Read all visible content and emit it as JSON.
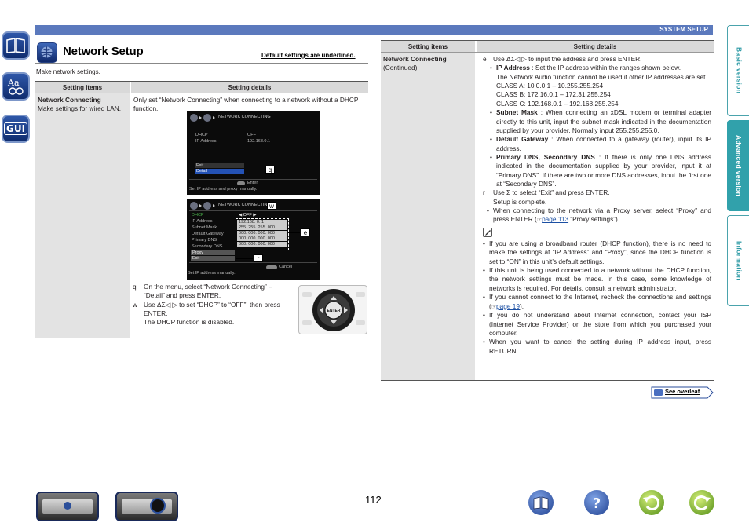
{
  "header": {
    "section": "SYSTEM SETUP"
  },
  "page": {
    "title": "Network Setup",
    "defaults_note": "Default settings are underlined.",
    "intro": "Make network settings.",
    "number": "112"
  },
  "left_table": {
    "col1": "Setting items",
    "col2": "Setting details",
    "item_name": "Network Connecting",
    "item_desc": "Make settings for wired LAN.",
    "details": "Only set “Network Connecting” when connecting to a network without a DHCP function.",
    "steps": [
      {
        "num": "q",
        "text": "On the menu, select “Network Connecting” – “Detail” and press ENTER."
      },
      {
        "num": "w",
        "text": "Use ΔΣ◁ ▷ to set “DHCP” to “OFF”, then press ENTER."
      },
      {
        "num": "",
        "text": "The DHCP function is disabled."
      }
    ]
  },
  "screen1": {
    "title": "NETWORK CONNECTING",
    "rows": [
      {
        "label": "DHCP",
        "value": "OFF"
      },
      {
        "label": "IP Address",
        "value": "192.168.0.1"
      }
    ],
    "menu": [
      "Exit",
      "Detail"
    ],
    "enter": "Enter",
    "hint": "Set IP address and proxy manually."
  },
  "screen2": {
    "title": "NETWORK CONNECTING",
    "rows": [
      {
        "label": "DHCP",
        "value": "OFF"
      },
      {
        "label": "IP Address",
        "value": "192.168.  0.  1"
      },
      {
        "label": "Subnet Mask",
        "value": "255. 255. 255. 000"
      },
      {
        "label": "Default Gateway",
        "value": "000. 000. 000. 000"
      },
      {
        "label": "Primary DNS",
        "value": "000. 000. 000. 000"
      },
      {
        "label": "Secondary DNS",
        "value": "000. 000. 000. 000"
      }
    ],
    "menu": [
      "Proxy",
      "Exit"
    ],
    "cancel": "Cancel",
    "hint": "Set IP address manually."
  },
  "callouts": [
    "q",
    "w",
    "e",
    "r"
  ],
  "remote": {
    "center": "ENTER"
  },
  "right_table": {
    "col1": "Setting items",
    "col2": "Setting details",
    "item_name": "Network Connecting",
    "item_sub": "(Continued)",
    "step3": "Use ΔΣ◁ ▷ to input the address and press ENTER.",
    "ip_label": "IP Address",
    "ip_text": ": Set the IP address within the ranges shown below.",
    "ip_note": "The Network Audio function cannot be used if other IP addresses are set.",
    "classes": [
      "CLASS A: 10.0.0.1 – 10.255.255.254",
      "CLASS B: 172.16.0.1 – 172.31.255.254",
      "CLASS C: 192.168.0.1 – 192.168.255.254"
    ],
    "subnet_label": "Subnet Mask",
    "subnet_text": ": When connecting an xDSL modem or terminal adapter directly to this unit, input the subnet mask indicated in the documentation supplied by your provider. Normally input 255.255.255.0.",
    "gateway_label": "Default Gateway",
    "gateway_text": ": When connected to a gateway (router), input its IP address.",
    "dns_label": "Primary DNS, Secondary DNS",
    "dns_text": ": If there is only one DNS address indicated in the documentation supplied by your provider, input it at “Primary DNS”. If there are two or more DNS addresses, input the first one at “Secondary DNS”.",
    "step4": "Use Σ to select “Exit” and press ENTER.",
    "step4b": "Setup is complete.",
    "proxy_note_a": "When connecting to the network via a Proxy server, select “Proxy” and press ENTER (",
    "proxy_link": "page 113",
    "proxy_note_b": " “Proxy settings”).",
    "notes": [
      "If you are using a broadband router (DHCP function), there is no need to make the settings at “IP Address” and “Proxy”, since the DHCP function is set to “ON” in this unit’s default settings.",
      "If this unit is being used connected to a network without the DHCP function, the network settings must be made. In this case, some knowledge of networks is required. For details, consult a network administrator."
    ],
    "note_internet_a": "If you cannot connect to the Internet, recheck the connections and settings (",
    "note_internet_link": "page 19",
    "note_internet_b": ").",
    "notes2": [
      "If you do not understand about Internet connection, contact your ISP (Internet Service Provider) or the store from which you purchased your computer."
    ],
    "note_cancel": "When you want to cancel the setting during IP address input, press RETURN."
  },
  "tabs": [
    "Basic version",
    "Advanced version",
    "Information"
  ],
  "overleaf": "See overleaf",
  "icons": [
    "book-icon",
    "aa-icon",
    "gui-icon",
    "network-icon",
    "remote-icon",
    "help-icon",
    "back-icon",
    "forward-icon",
    "index-book-icon"
  ],
  "colors": {
    "header_blue": "#5b79bd",
    "tab_teal": "#31a1ab"
  }
}
